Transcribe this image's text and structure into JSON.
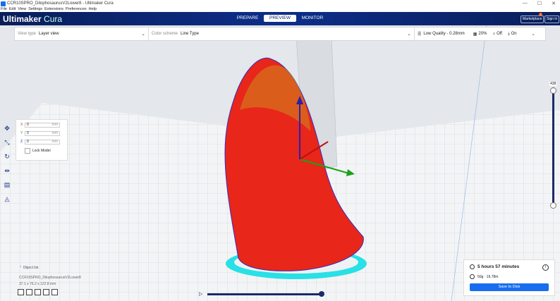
{
  "window": {
    "title": "CCR10SPRO_DilophosaurusV2Lower8 - Ultimaker Cura",
    "min": "—",
    "max": "☐",
    "close": "✕"
  },
  "menu": [
    "File",
    "Edit",
    "View",
    "Settings",
    "Extensions",
    "Preferences",
    "Help"
  ],
  "header": {
    "logo_bold": "Ultimaker",
    "logo_light": " Cura",
    "stages": [
      "PREPARE",
      "PREVIEW",
      "MONITOR"
    ],
    "active_stage": "PREVIEW",
    "marketplace": "Marketplace",
    "signin": "Sign in",
    "badge": "1"
  },
  "toolbar": {
    "view_type_label": "View type",
    "view_type_value": "Layer view",
    "color_scheme_label": "Color scheme",
    "color_scheme_value": "Line Type",
    "quality": "Low Quality - 0.28mm",
    "infill": "20%",
    "support": "Off",
    "adhesion": "On"
  },
  "move_panel": {
    "x_label": "X",
    "y_label": "Y",
    "z_label": "Z",
    "x": "0",
    "y": "0",
    "z": "0",
    "unit": "mm",
    "lock_label": "Lock Model"
  },
  "objects": {
    "list_label": "Object list",
    "item": "CCR10SPRO_DilophosaurusV2Lower8",
    "dims": "37.1 x 76.2 x 122.8 mm"
  },
  "layer": {
    "max": "438",
    "fraction": 1.0
  },
  "output": {
    "time": "5 hours 57 minutes",
    "material": "50g · 16.78m",
    "save": "Save to Disk"
  },
  "colors": {
    "accent": "#196ef0",
    "header": "#0c2e8a",
    "model": "#e8261a",
    "skirt": "#29e0e6"
  }
}
